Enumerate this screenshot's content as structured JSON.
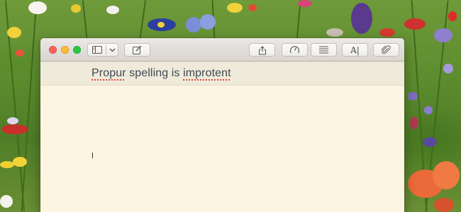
{
  "window": {
    "title_line": {
      "words": [
        {
          "text": "Propur",
          "misspelled": true
        },
        {
          "text": " spelling is ",
          "misspelled": false
        },
        {
          "text": "improtent",
          "misspelled": true
        }
      ]
    }
  },
  "toolbar": {
    "left_icons": [
      "sidebar-icon",
      "chevron-down-icon",
      "compose-icon"
    ],
    "right_icons": [
      "share-icon",
      "gauge-icon",
      "list-icon",
      "text-format-icon",
      "paperclip-icon"
    ],
    "format_label": "A|"
  },
  "colors": {
    "window_background": "#fdf5e2",
    "title_line_background": "#efead9",
    "spell_underline": "#e0443a",
    "text": "#3f4a55"
  }
}
